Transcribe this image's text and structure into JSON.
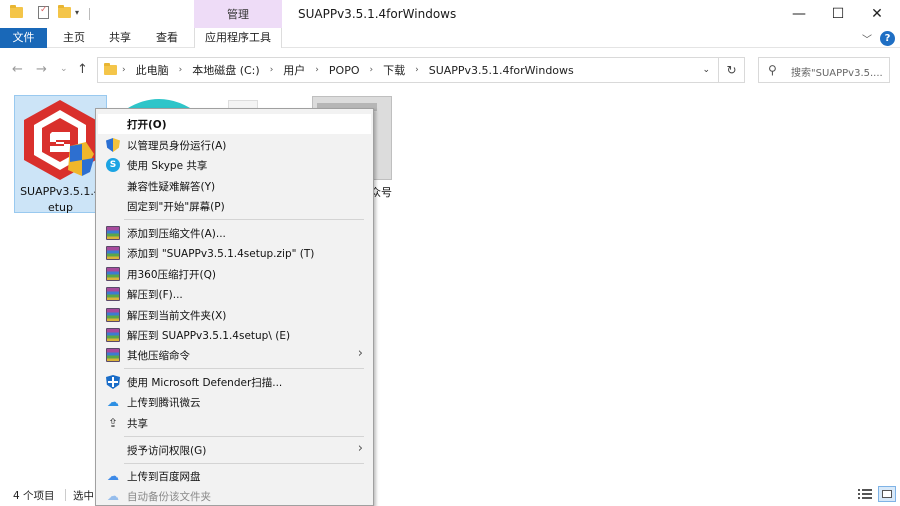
{
  "titlebar": {
    "title": "SUAPPv3.5.1.4forWindows",
    "manage_tab": "管理",
    "minimize": "—",
    "maximize": "☐",
    "close": "✕"
  },
  "ribbon": {
    "tabs": [
      "文件",
      "主页",
      "共享",
      "查看",
      "应用程序工具"
    ],
    "help": "?"
  },
  "address": {
    "crumbs": [
      "此电脑",
      "本地磁盘 (C:)",
      "用户",
      "POPO",
      "下载",
      "SUAPPv3.5.1.4forWindows"
    ],
    "search_placeholder": "搜索\"SUAPPv3.5...."
  },
  "files": [
    {
      "name": "SUAPPv3.5.1.4setup",
      "visible_label_line1": "SUAPPv3.5.1.4",
      "visible_label_line2": "etup",
      "selected": true
    },
    {
      "name": "",
      "partial_label": "众号"
    }
  ],
  "context_menu": {
    "items": [
      {
        "label": "打开(O)",
        "icon": "none",
        "bold": true,
        "hover": true
      },
      {
        "label": "以管理员身份运行(A)",
        "icon": "uac-shield-icon"
      },
      {
        "label": "使用 Skype 共享",
        "icon": "skype-icon"
      },
      {
        "label": "兼容性疑难解答(Y)",
        "icon": "none"
      },
      {
        "label": "固定到\"开始\"屏幕(P)",
        "icon": "none"
      },
      {
        "label": "添加到压缩文件(A)...",
        "icon": "winrar-icon"
      },
      {
        "label": "添加到 \"SUAPPv3.5.1.4setup.zip\" (T)",
        "icon": "winrar-icon"
      },
      {
        "label": "用360压缩打开(Q)",
        "icon": "winrar-icon"
      },
      {
        "label": "解压到(F)...",
        "icon": "winrar-icon"
      },
      {
        "label": "解压到当前文件夹(X)",
        "icon": "winrar-icon"
      },
      {
        "label": "解压到 SUAPPv3.5.1.4setup\\ (E)",
        "icon": "winrar-icon"
      },
      {
        "label": "其他压缩命令",
        "icon": "winrar-icon",
        "submenu": true
      },
      {
        "label": "使用 Microsoft Defender扫描...",
        "icon": "defender-icon"
      },
      {
        "label": "上传到腾讯微云",
        "icon": "weiyun-cloud-icon"
      },
      {
        "label": "共享",
        "icon": "share-icon"
      },
      {
        "label": "授予访问权限(G)",
        "icon": "none",
        "submenu": true
      },
      {
        "label": "上传到百度网盘",
        "icon": "baidu-cloud-icon"
      },
      {
        "label": "自动备份该文件夹",
        "icon": "baidu-cloud-icon",
        "disabled": true
      }
    ]
  },
  "status": {
    "count": "4 个项目",
    "selected": "选中"
  }
}
